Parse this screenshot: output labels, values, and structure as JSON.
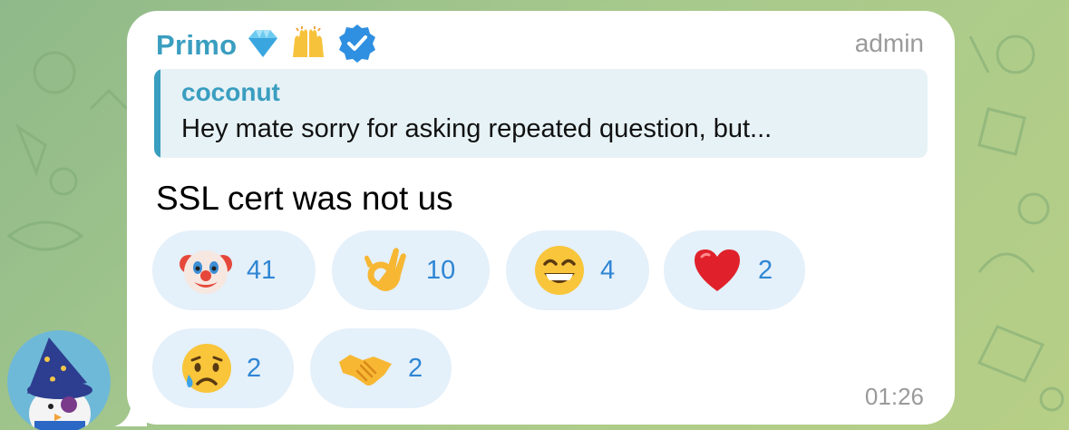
{
  "message": {
    "sender": "Primo",
    "role": "admin",
    "text": "SSL cert was not us",
    "time": "01:26",
    "sender_badges": [
      "diamond-emoji",
      "raising-hands-emoji",
      "verified-icon"
    ]
  },
  "reply": {
    "author": "coconut",
    "text": "Hey mate sorry for asking repeated question, but..."
  },
  "reactions": [
    {
      "emoji": "clown-face",
      "count": "41"
    },
    {
      "emoji": "ok-hand",
      "count": "10"
    },
    {
      "emoji": "grinning-face",
      "count": "4"
    },
    {
      "emoji": "red-heart",
      "count": "2"
    },
    {
      "emoji": "crying-face",
      "count": "2"
    },
    {
      "emoji": "handshake",
      "count": "2"
    }
  ],
  "colors": {
    "accent": "#3a9ec0",
    "reaction_text": "#2f86d4",
    "reaction_bg": "#e4f0fa",
    "meta": "#9a9a9a"
  }
}
